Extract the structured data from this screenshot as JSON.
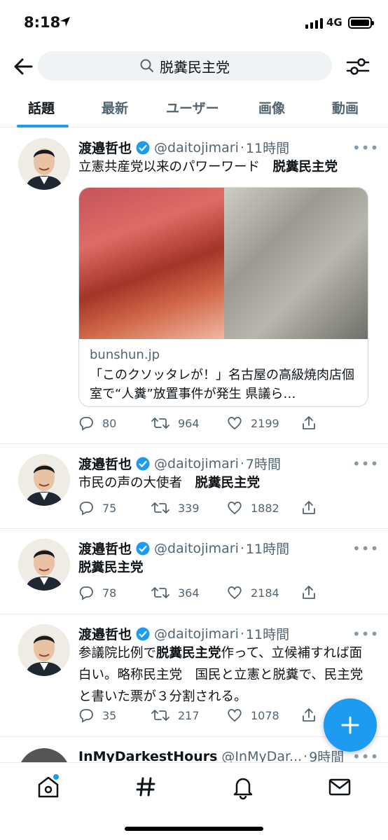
{
  "status": {
    "time": "8:18",
    "network": "4G"
  },
  "search": {
    "query": "脱糞民主党"
  },
  "tabs": [
    "話題",
    "最新",
    "ユーザー",
    "画像",
    "動画"
  ],
  "tweets": [
    {
      "name": "渡邉哲也",
      "handle": "@daitojimari",
      "time": "11時間",
      "text_plain": "立憲共産党以来のパワーワード　",
      "text_bold": "脱糞民主党",
      "card": {
        "domain": "bunshun.jp",
        "title": "「このクソッタレが！」名古屋の高級焼肉店個室で“人糞”放置事件が発生 県議ら…"
      },
      "replies": "80",
      "retweets": "964",
      "likes": "2199"
    },
    {
      "name": "渡邉哲也",
      "handle": "@daitojimari",
      "time": "7時間",
      "text_plain": "市民の声の大使者　",
      "text_bold": "脱糞民主党",
      "replies": "75",
      "retweets": "339",
      "likes": "1882"
    },
    {
      "name": "渡邉哲也",
      "handle": "@daitojimari",
      "time": "11時間",
      "text_plain": "",
      "text_bold": "脱糞民主党",
      "replies": "78",
      "retweets": "364",
      "likes": "2184"
    },
    {
      "name": "渡邉哲也",
      "handle": "@daitojimari",
      "time": "11時間",
      "text_pre": "参議院比例で",
      "text_bold": "脱糞民主党",
      "text_post": "作って、立候補すれば面白い。略称民主党　国民と立憲と脱糞で、民主党と書いた票が３分割される。",
      "replies": "35",
      "retweets": "217",
      "likes": "1078"
    },
    {
      "name": "InMyDarkestHours",
      "handle": "@InMyDar...",
      "time": "9時間"
    }
  ],
  "separator": "·",
  "more_glyph": "•••",
  "colors": {
    "accent": "#1d9bf0",
    "verified": "#1d9bf0",
    "text": "#0f1419",
    "secondary": "#536471"
  },
  "icons": {
    "back": "arrow-left-icon",
    "search": "magnifier-icon",
    "filter": "sliders-icon",
    "home": "home-icon",
    "explore": "hashtag-icon",
    "notifications": "bell-icon",
    "messages": "envelope-icon",
    "compose": "plus-icon"
  }
}
